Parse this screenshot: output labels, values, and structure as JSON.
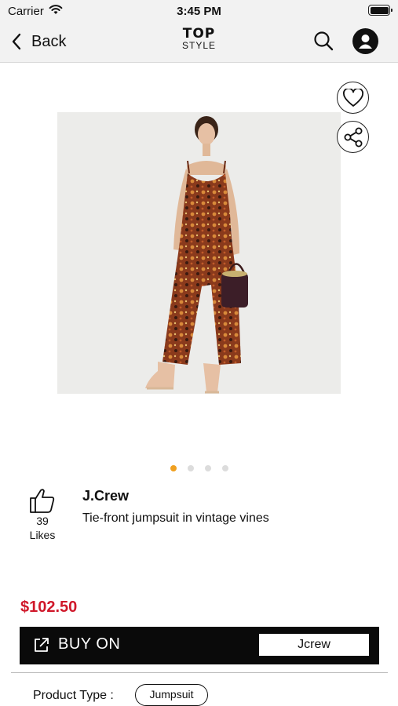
{
  "status_bar": {
    "carrier": "Carrier",
    "time": "3:45 PM"
  },
  "nav": {
    "back_label": "Back",
    "logo_top": "TOP",
    "logo_bottom": "STYLE",
    "icons": [
      "chevron-left-icon",
      "search-icon",
      "user-icon"
    ]
  },
  "product": {
    "brand": "J.Crew",
    "name": "Tie-front jumpsuit in vintage vines",
    "likes_count": "39",
    "likes_label": "Likes",
    "price": "$102.50",
    "image_count": 4,
    "active_image": 1
  },
  "actions": {
    "favorite_icon": "heart-icon",
    "share_icon": "share-icon",
    "like_icon": "thumbs-up-icon"
  },
  "buy": {
    "label": "BUY ON",
    "store": "Jcrew",
    "icon": "external-link-icon"
  },
  "details": {
    "product_type_label": "Product Type :",
    "product_type_value": "Jumpsuit"
  },
  "colors": {
    "price_red": "#d0182a",
    "dot_active": "#f0a020",
    "buy_bar": "#0a0a0a"
  }
}
